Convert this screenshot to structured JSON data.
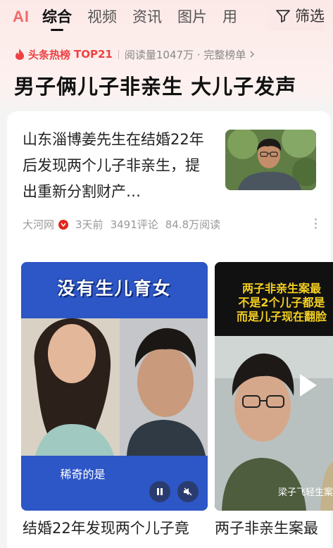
{
  "tabs": {
    "ai": "AI",
    "items": [
      "综合",
      "视频",
      "资讯",
      "图片",
      "用"
    ],
    "filter": "筛选"
  },
  "hot": {
    "label": "头条热榜",
    "rank": "TOP21",
    "reads": "阅读量1047万 · 完整榜单"
  },
  "headline": "男子俩儿子非亲生 大儿子发声",
  "article": {
    "title": "山东淄博姜先生在结婚22年后发现两个儿子非亲生，提出重新分割财产…",
    "source": "大河网",
    "time": "3天前",
    "comments": "3491评论",
    "reads": "84.8万阅读"
  },
  "video1": {
    "banner": "没有生儿育女",
    "caption": "稀奇的是",
    "title": "结婚22年发现两个儿子竟"
  },
  "video2": {
    "overlay_lines": [
      "两子非亲生案最",
      "不是2个儿子都是",
      "而是儿子现在翻脸"
    ],
    "watermark": "梁子飞轻生案",
    "title": "两子非亲生案最"
  },
  "colors": {
    "accent_red": "#f04142",
    "ai_pink": "#f06a6a",
    "video1_bg": "#2d56c6",
    "overlay_yellow": "#f5d020"
  }
}
